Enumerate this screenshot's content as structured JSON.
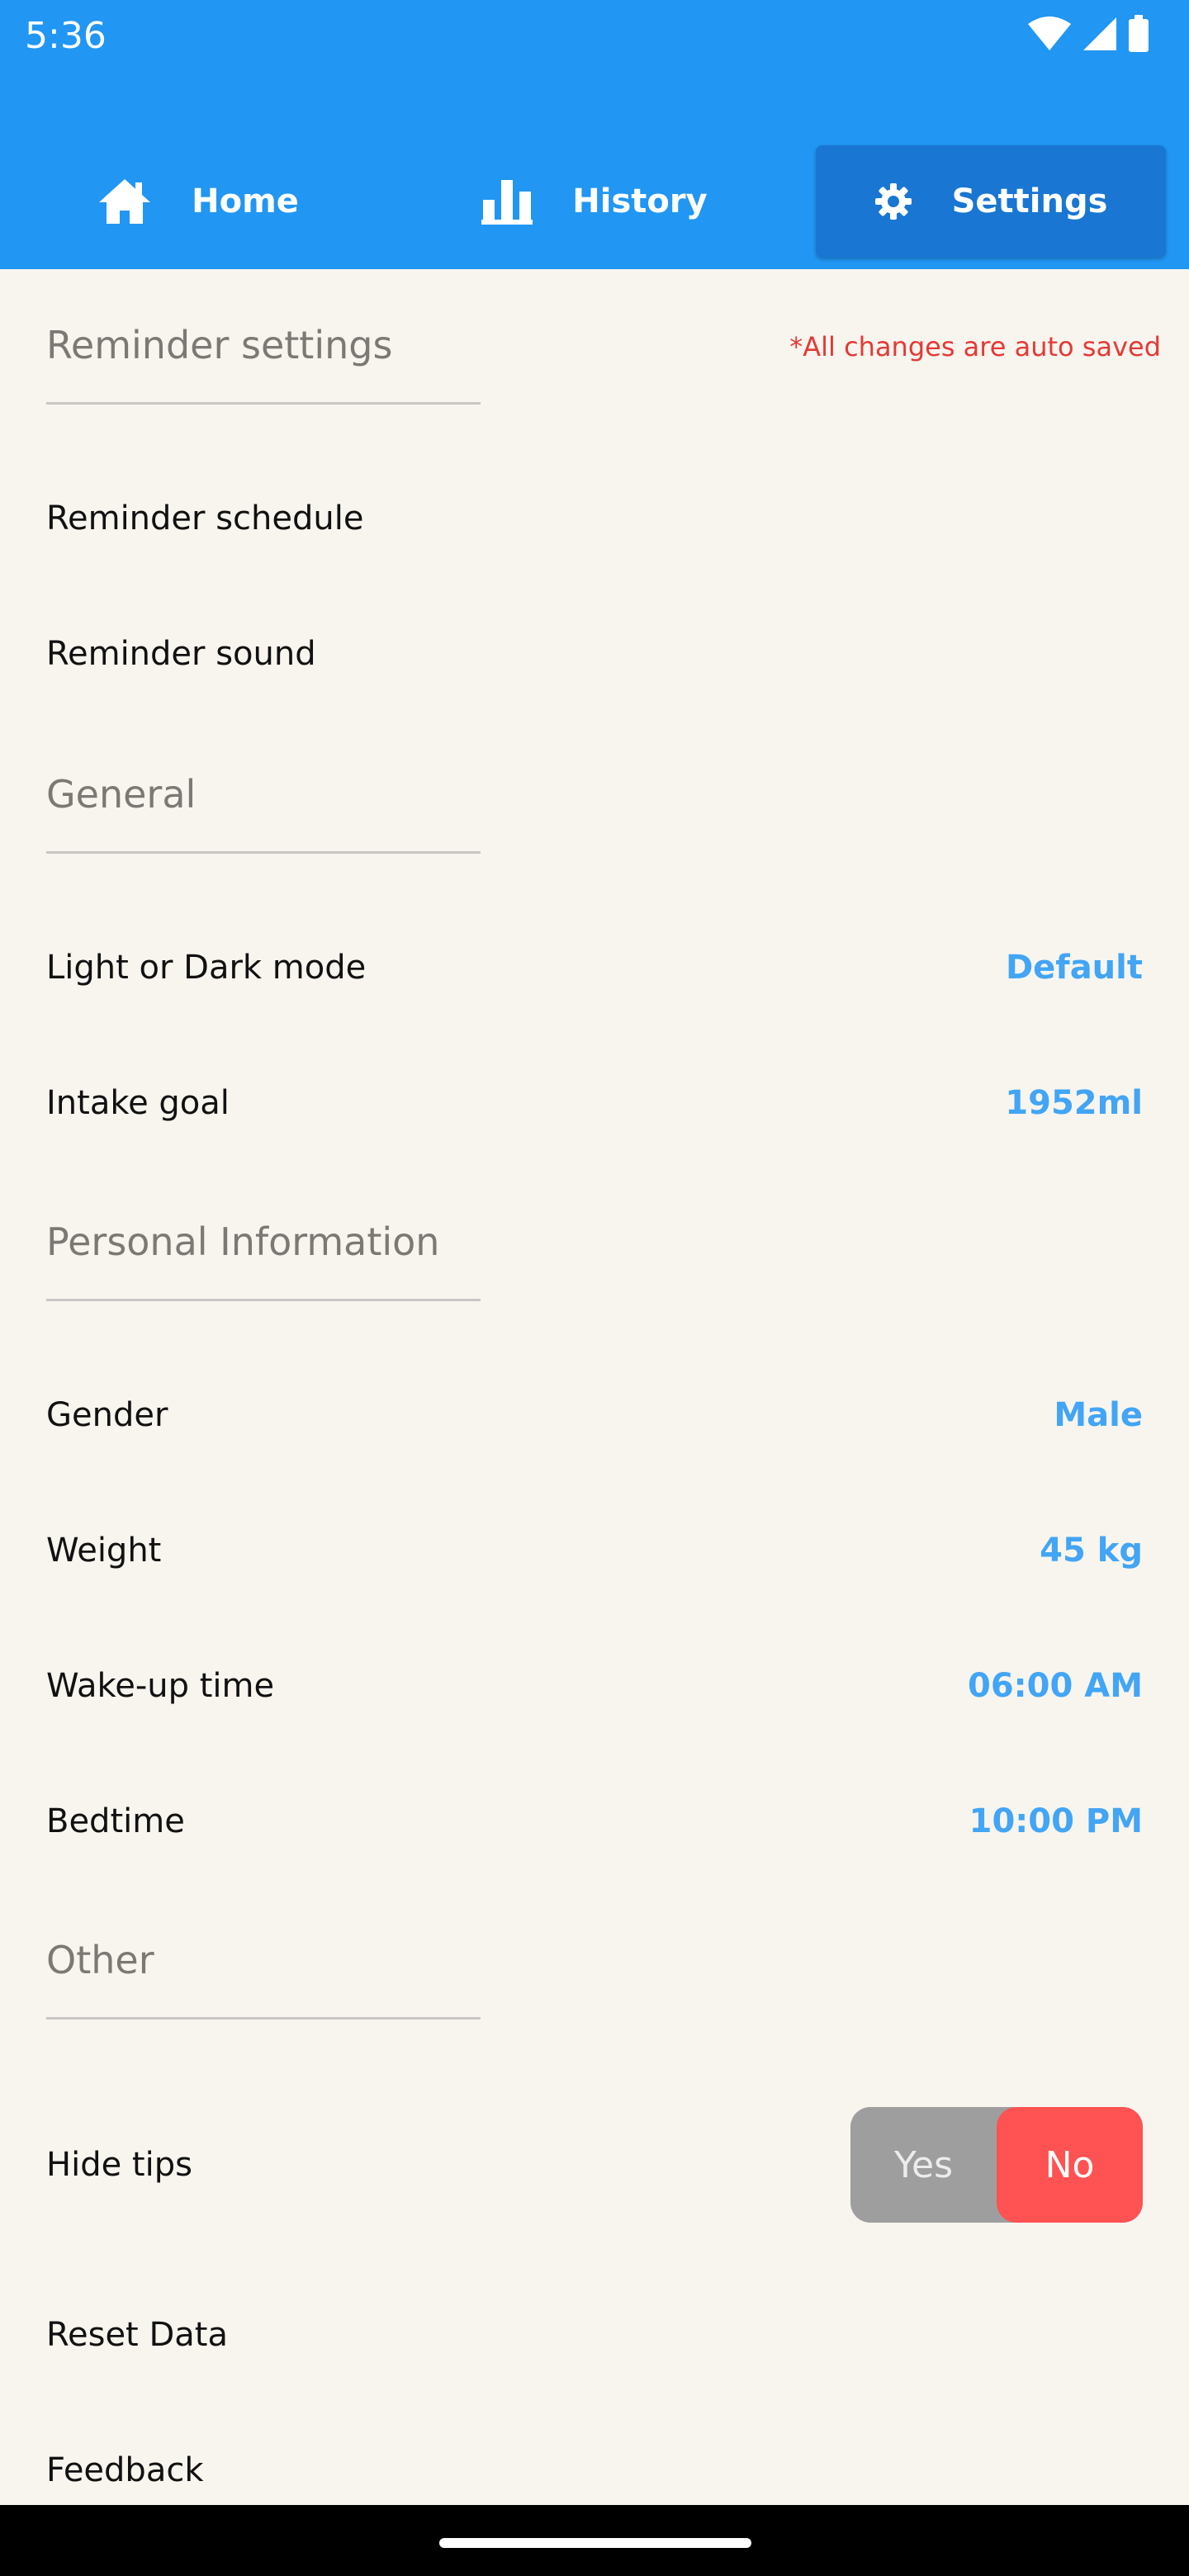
{
  "status_bar": {
    "time": "5:36",
    "icons": [
      "wifi-icon",
      "signal-icon",
      "battery-icon"
    ]
  },
  "tabs": [
    {
      "label": "Home",
      "icon": "home-icon",
      "active": false
    },
    {
      "label": "History",
      "icon": "bar-chart-icon",
      "active": false
    },
    {
      "label": "Settings",
      "icon": "gear-icon",
      "active": true
    }
  ],
  "sections": {
    "reminder": {
      "title": "Reminder settings",
      "note": "*All changes are auto saved",
      "schedule_label": "Reminder schedule",
      "sound_label": "Reminder sound"
    },
    "general": {
      "title": "General",
      "theme_label": "Light or Dark mode",
      "theme_value": "Default",
      "goal_label": "Intake goal",
      "goal_value": "1952ml"
    },
    "personal": {
      "title": "Personal Information",
      "gender_label": "Gender",
      "gender_value": "Male",
      "weight_label": "Weight",
      "weight_value": "45 kg",
      "wake_label": "Wake-up time",
      "wake_value": "06:00 AM",
      "bed_label": "Bedtime",
      "bed_value": "10:00 PM"
    },
    "other": {
      "title": "Other",
      "hide_tips_label": "Hide tips",
      "hide_tips_yes": "Yes",
      "hide_tips_no": "No",
      "hide_tips_selected": "No",
      "reset_label": "Reset Data",
      "feedback_label": "Feedback"
    }
  },
  "colors": {
    "header": "#2196f3",
    "active_tab": "#1976d2",
    "value_accent": "#42a5f5",
    "auto_saved": "#e53935",
    "toggle_selected": "#ff5252",
    "background": "#f8f5ef"
  }
}
